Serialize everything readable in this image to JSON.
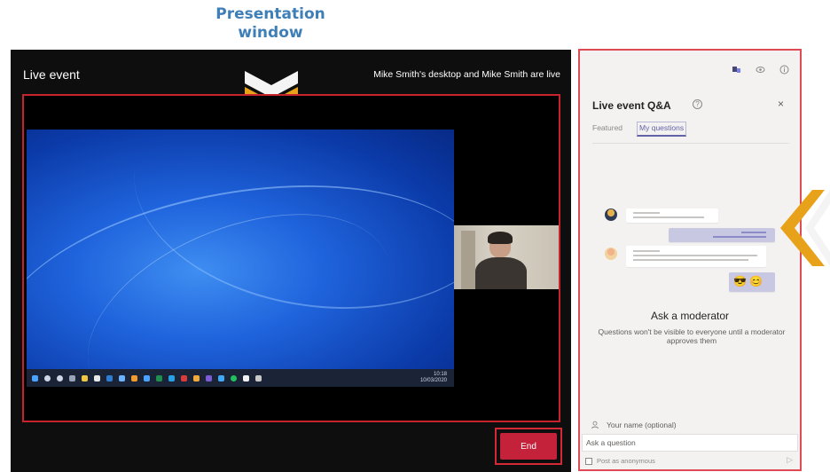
{
  "callout": {
    "line1": "Presentation",
    "line2": "window"
  },
  "stage": {
    "title": "Live event",
    "status": "Mike Smith's desktop and Mike Smith are live",
    "end_label": "End",
    "taskbar_clock_line1": "10:18",
    "taskbar_clock_line2": "10/03/2020"
  },
  "qa": {
    "title": "Live event Q&A",
    "help_glyph": "?",
    "close_glyph": "×",
    "tabs": [
      {
        "label": "Featured",
        "active": false
      },
      {
        "label": "My questions",
        "active": true
      }
    ],
    "heading": "Ask a moderator",
    "subtext": "Questions won't be visible to everyone until a moderator approves them",
    "name_placeholder": "Your name (optional)",
    "ask_placeholder": "Ask a question",
    "anonymous_label": "Post as anonymous",
    "emoji": "😎 😊"
  },
  "colors": {
    "accent_red": "#c4223a",
    "frame_red": "#c7232d",
    "chevron_orange": "#e8a21a",
    "teams_purple": "#6264a7",
    "callout_blue": "#3f7fb8"
  },
  "icons": [
    "chevron-down-icon",
    "chevron-left-icon",
    "people-icon",
    "eye-icon",
    "info-icon",
    "help-icon",
    "close-icon",
    "person-icon",
    "send-icon",
    "webcam-feed"
  ]
}
